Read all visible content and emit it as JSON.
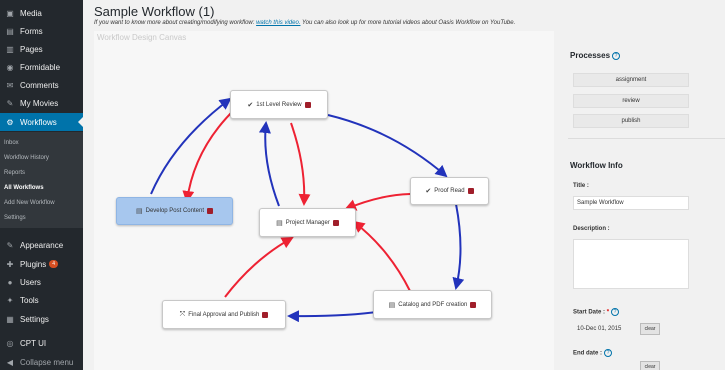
{
  "sidebar": {
    "items": [
      {
        "label": "Media",
        "icon": "media-icon",
        "glyph": "▣"
      },
      {
        "label": "Forms",
        "icon": "forms-icon",
        "glyph": "▤"
      },
      {
        "label": "Pages",
        "icon": "pages-icon",
        "glyph": "▥"
      },
      {
        "label": "Formidable",
        "icon": "formidable-icon",
        "glyph": "◉"
      },
      {
        "label": "Comments",
        "icon": "comments-icon",
        "glyph": "✉"
      },
      {
        "label": "My Movies",
        "icon": "movies-icon",
        "glyph": "✎"
      },
      {
        "label": "Workflows",
        "icon": "workflows-icon",
        "glyph": "⚙"
      },
      {
        "label": "Appearance",
        "icon": "appearance-icon",
        "glyph": "✎"
      },
      {
        "label": "Plugins",
        "icon": "plugins-icon",
        "glyph": "✚",
        "badge": "4"
      },
      {
        "label": "Users",
        "icon": "users-icon",
        "glyph": "●"
      },
      {
        "label": "Tools",
        "icon": "tools-icon",
        "glyph": "✦"
      },
      {
        "label": "Settings",
        "icon": "settings-icon",
        "glyph": "▦"
      },
      {
        "label": "CPT UI",
        "icon": "cptui-icon",
        "glyph": "◎"
      },
      {
        "label": "Collapse menu",
        "icon": "collapse-icon",
        "glyph": "◀"
      }
    ],
    "submenu": [
      "Inbox",
      "Workflow History",
      "Reports",
      "All Workflows",
      "Add New Workflow",
      "Settings"
    ],
    "colors": {
      "bg": "#23282d",
      "active": "#0073aa",
      "submenu_bg": "#32373c"
    }
  },
  "main": {
    "title": "Sample Workflow (1)",
    "info_prefix": "If you want to know more about creating/modifying workflow:",
    "info_link": "watch this video.",
    "info_suffix": "You can also look up for more tutorial videos about Oasis Workflow on YouTube.",
    "canvas_label": "Workflow Design Canvas"
  },
  "steps": [
    {
      "id": "first-level-review",
      "label": "1st Level Review",
      "icon": "check-icon",
      "glyph": "✔"
    },
    {
      "id": "proof-read",
      "label": "Proof Read",
      "icon": "check-icon",
      "glyph": "✔"
    },
    {
      "id": "develop-content",
      "label": "Develop Post Content",
      "icon": "document-icon",
      "glyph": "▤"
    },
    {
      "id": "project-manager",
      "label": "Project Manager",
      "icon": "document-icon",
      "glyph": "▤"
    },
    {
      "id": "catalog-pdf",
      "label": "Catalog and PDF creation",
      "icon": "document-icon",
      "glyph": "▤"
    },
    {
      "id": "final-approval",
      "label": "Final Approval and Publish",
      "icon": "publish-icon",
      "glyph": "⤧"
    }
  ],
  "arrow_colors": {
    "success": "#2233bb",
    "failure": "#ee2233"
  },
  "panel": {
    "processes_title": "Processes",
    "processes": [
      "assignment",
      "review",
      "publish"
    ],
    "info_title": "Workflow Info",
    "title_label": "Title :",
    "title_value": "Sample Workflow",
    "description_label": "Description :",
    "start_date_label": "Start Date :",
    "start_required": "*",
    "start_date_value": "10-Dec 01, 2015",
    "clear_label": "clear",
    "end_date_label": "End date :"
  }
}
